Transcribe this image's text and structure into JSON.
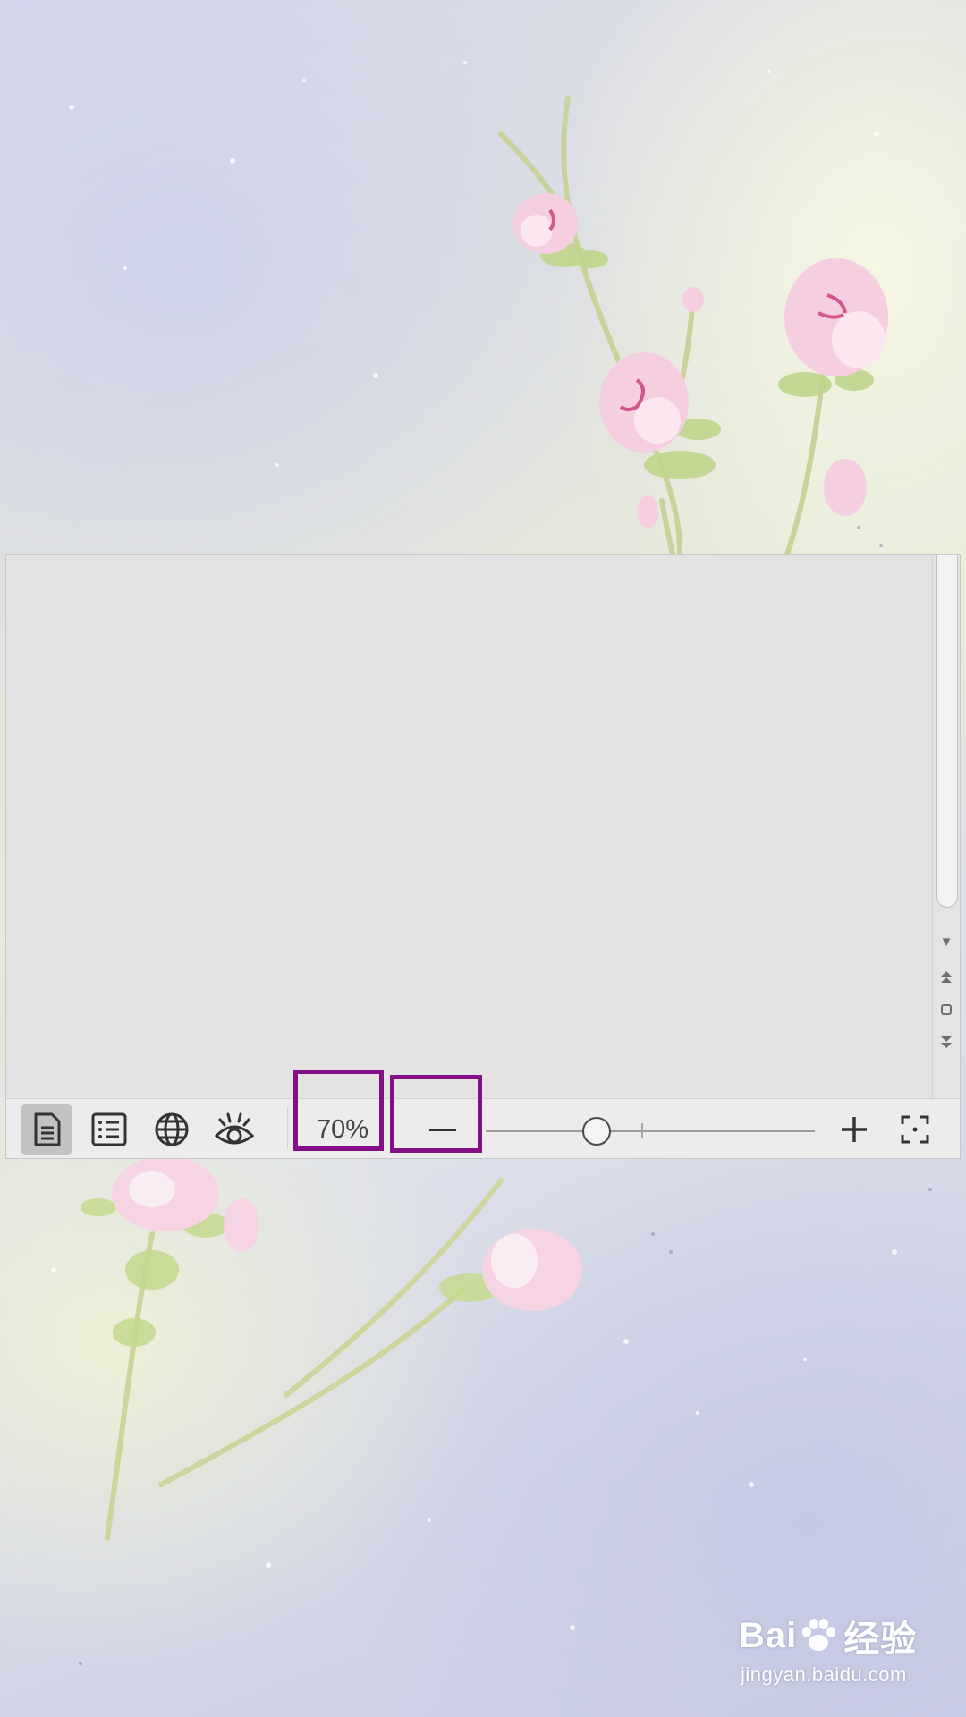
{
  "statusbar": {
    "view_buttons": [
      {
        "icon": "document-icon",
        "active": true
      },
      {
        "icon": "outline-list-icon",
        "active": false
      },
      {
        "icon": "globe-icon",
        "active": false
      },
      {
        "icon": "eye-icon",
        "active": false
      }
    ],
    "zoom": {
      "level_text": "70%",
      "level": 70,
      "out_icon": "minus-icon",
      "in_icon": "plus-icon",
      "fit_icon": "fit-screen-icon"
    }
  },
  "scrollbar": {
    "buttons": [
      "down-arrow-icon",
      "previous-page-icon",
      "browse-object-icon",
      "next-page-icon"
    ]
  },
  "highlight_color": "#840e86",
  "watermark": {
    "brand_left": "Bai",
    "brand_right": "经验",
    "url": "jingyan.baidu.com"
  }
}
